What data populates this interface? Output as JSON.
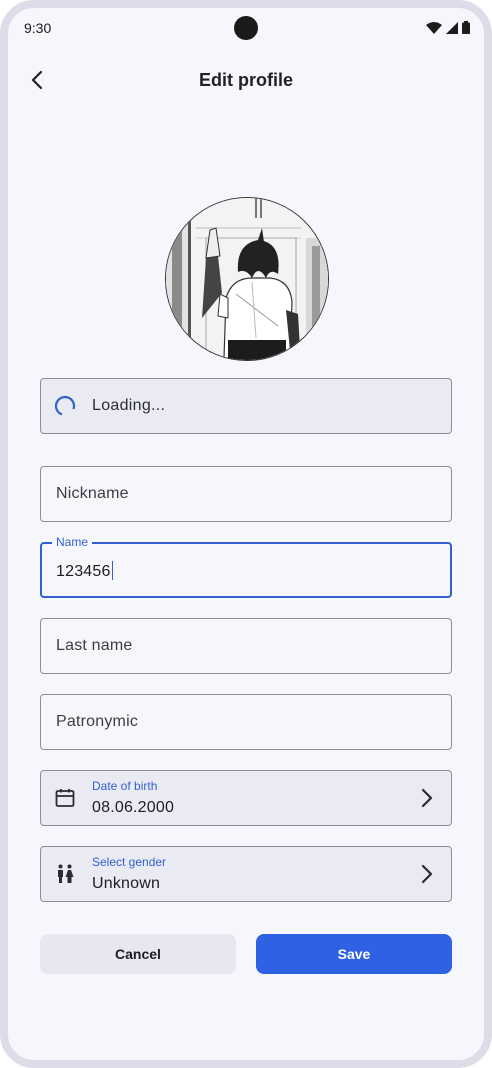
{
  "status_bar": {
    "time": "9:30"
  },
  "appbar": {
    "title": "Edit profile"
  },
  "avatar": {
    "alt": "Profile photo"
  },
  "city_field": {
    "loading_text": "Loading..."
  },
  "nickname_field": {
    "label": "Nickname",
    "value": ""
  },
  "name_field": {
    "label": "Name",
    "value": "123456"
  },
  "last_name_field": {
    "label": "Last name",
    "value": ""
  },
  "patronymic_field": {
    "label": "Patronymic",
    "value": ""
  },
  "dob_field": {
    "label": "Date of birth",
    "value": "08.06.2000",
    "icon": "calendar-icon"
  },
  "gender_field": {
    "label": "Select gender",
    "value": "Unknown",
    "icon": "gender-icon"
  },
  "actions": {
    "cancel_label": "Cancel",
    "save_label": "Save"
  },
  "colors": {
    "accent": "#2f61e4",
    "focus": "#3360cf",
    "background": "#f6f7fc"
  }
}
